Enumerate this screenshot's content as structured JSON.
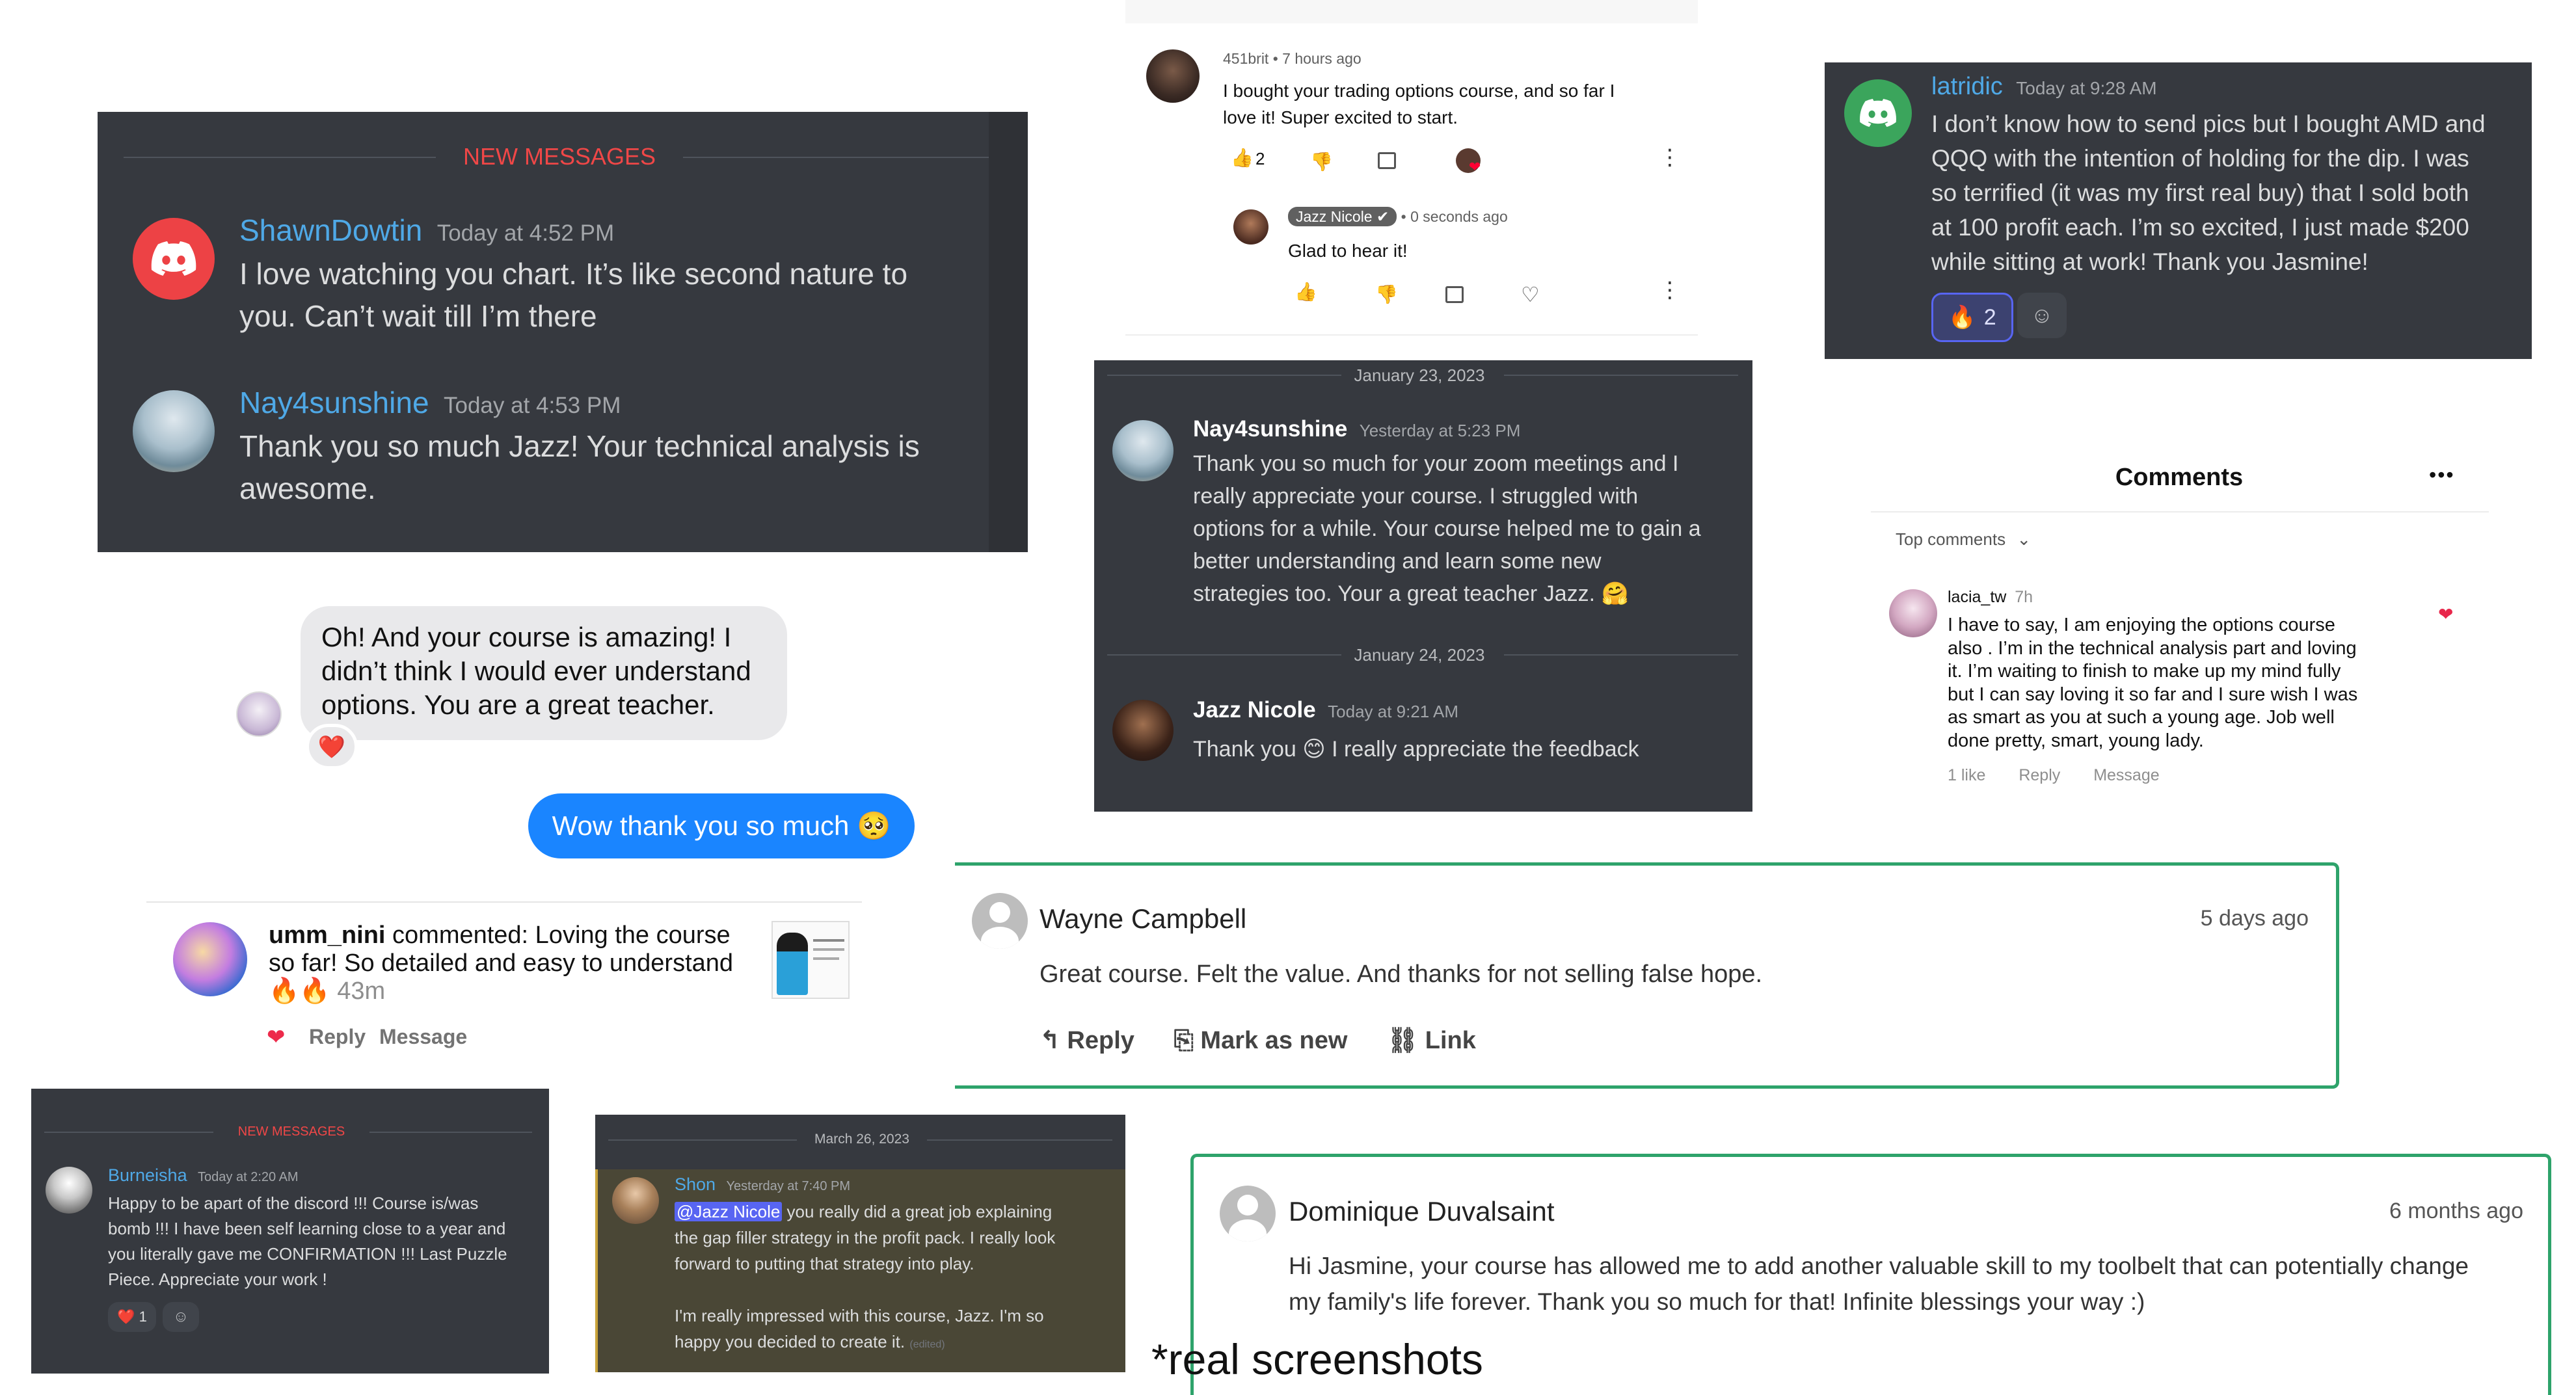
{
  "card1": {
    "new_messages": "NEW MESSAGES",
    "msg1": {
      "user": "ShawnDowtin",
      "time": "Today at 4:52 PM",
      "text1": "I love watching you chart. It’s like second nature to",
      "text2": "you. Can’t wait till I’m there"
    },
    "msg2": {
      "user": "Nay4sunshine",
      "time": "Today at 4:53 PM",
      "text1": "Thank you so much Jazz! Your technical analysis is",
      "text2": "awesome."
    }
  },
  "chat": {
    "incoming": [
      "Oh!  And your course is amazing!  I",
      "didn’t think I would ever understand",
      "options.  You are a great teacher."
    ],
    "reaction": "❤️",
    "outgoing": "Wow thank you so much 🥺"
  },
  "insta": {
    "user": "umm_nini",
    "line1": " commented: Loving the course",
    "line2": "so far! So detailed and easy to understand",
    "emojis": "🔥🔥",
    "time": "43m",
    "reply": "Reply",
    "message": "Message"
  },
  "card_burneisha": {
    "new_messages": "NEW MESSAGES",
    "user": "Burneisha",
    "time": "Today at 2:20 AM",
    "lines": [
      "Happy to be apart of the discord !!! Course is/was",
      "bomb !!! I have been self learning close to a year and",
      "you literally gave me CONFIRMATION !!! Last Puzzle",
      "Piece. Appreciate your work !"
    ],
    "reaction": "❤️",
    "reaction_count": "1"
  },
  "card_shon": {
    "date": "March 26, 2023",
    "user": "Shon",
    "time": "Yesterday at 7:40 PM",
    "mention": "@Jazz Nicole",
    "line1": " you really did a great job explaining",
    "line2": "the gap filler strategy in the profit pack. I really look",
    "line3": "forward to putting that strategy into play.",
    "line4": "I'm really impressed with this course, Jazz. I'm so",
    "line5": "happy you decided to create it.",
    "edited": "(edited)"
  },
  "youtube": {
    "user": "451brit",
    "time": "7 hours ago",
    "text1": "I bought your trading options course, and so far I",
    "text2": "love it! Super excited to start.",
    "likes": "2",
    "reply_user": "Jazz Nicole",
    "reply_time": "0 seconds ago",
    "reply_text": "Glad to hear it!"
  },
  "card_nay": {
    "date1": "January 23, 2023",
    "user1": "Nay4sunshine",
    "time1": "Yesterday at 5:23 PM",
    "lines1": [
      "Thank you so much for your zoom meetings and I",
      "really appreciate your course. I struggled with",
      "options for a while. Your course helped me to gain a",
      "better understanding and learn some new",
      "strategies too. Your a great teacher Jazz. 🤗"
    ],
    "date2": "January 24, 2023",
    "user2": "Jazz Nicole",
    "time2": "Today at 9:21 AM",
    "text2": "Thank you 😊 I really appreciate the feedback"
  },
  "card_latridic": {
    "user": "latridic",
    "time": "Today at 9:28 AM",
    "lines": [
      "I don’t know how to send pics but I bought AMD and",
      "QQQ with the intention of holding for the dip. I was",
      "so terrified (it was my first real buy) that I sold both",
      "at 100 profit each. I’m so excited, I just made $200",
      "while sitting at work! Thank you Jasmine!"
    ],
    "reaction": "🔥",
    "reaction_count": "2"
  },
  "comments": {
    "title": "Comments",
    "more": "•••",
    "sort": "Top comments",
    "user": "lacia_tw",
    "time": "7h",
    "lines": [
      "I have to say, I am enjoying the options course",
      "also . I’m in the technical analysis part and loving",
      "it. I’m waiting to finish to make up my mind fully",
      "but I can say loving it so far and I sure wish I was",
      "as smart as you at such a young age. Job well",
      "done pretty, smart, young lady."
    ],
    "likes": "1 like",
    "reply": "Reply",
    "message": "Message"
  },
  "wayne": {
    "name": "Wayne Campbell",
    "time": "5 days ago",
    "text": "Great course. Felt the value. And thanks for not selling false hope.",
    "reply": "Reply",
    "mark": "Mark as new",
    "link": "Link"
  },
  "dominique": {
    "name": "Dominique Duvalsaint",
    "time": "6 months ago",
    "line1": "Hi Jasmine, your course has allowed me to add another valuable skill to my toolbelt that can potentially change",
    "line2": "my family's life forever. Thank you so much for that! Infinite blessings your way :)"
  },
  "footer": {
    "caption": "*real screenshots"
  }
}
